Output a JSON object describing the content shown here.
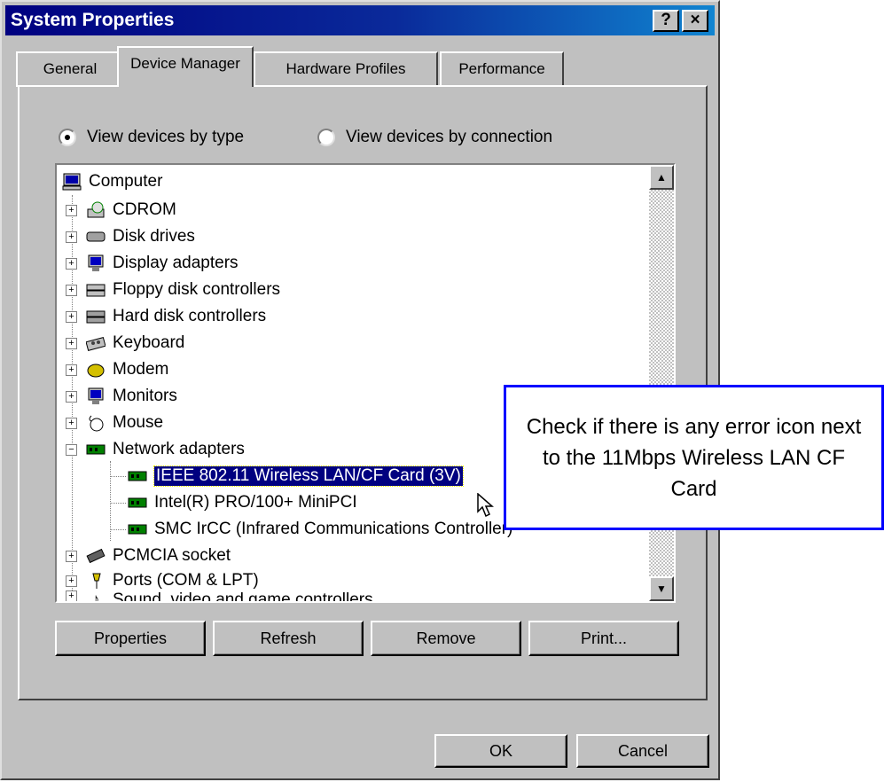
{
  "window": {
    "title": "System Properties",
    "help_glyph": "?",
    "close_glyph": "×"
  },
  "tabs": [
    {
      "label": "General"
    },
    {
      "label": "Device Manager",
      "active": true
    },
    {
      "label": "Hardware Profiles"
    },
    {
      "label": "Performance"
    }
  ],
  "view_options": {
    "by_type": "View devices by type",
    "by_connection": "View devices by connection"
  },
  "tree": {
    "root": "Computer",
    "items": [
      {
        "label": "CDROM",
        "icon": "cdrom-icon"
      },
      {
        "label": "Disk drives",
        "icon": "disk-drive-icon"
      },
      {
        "label": "Display adapters",
        "icon": "display-adapter-icon"
      },
      {
        "label": "Floppy disk controllers",
        "icon": "floppy-controller-icon"
      },
      {
        "label": "Hard disk controllers",
        "icon": "hard-disk-controller-icon"
      },
      {
        "label": "Keyboard",
        "icon": "keyboard-icon"
      },
      {
        "label": "Modem",
        "icon": "modem-icon"
      },
      {
        "label": "Monitors",
        "icon": "monitor-icon"
      },
      {
        "label": "Mouse",
        "icon": "mouse-icon"
      },
      {
        "label": "Network adapters",
        "icon": "network-adapter-icon"
      }
    ],
    "network_children": [
      {
        "label": "IEEE 802.11 Wireless LAN/CF Card (3V)"
      },
      {
        "label": "Intel(R) PRO/100+ MiniPCI"
      },
      {
        "label": "SMC IrCC (Infrared Communications Controller)"
      }
    ],
    "after_items": [
      {
        "label": "PCMCIA socket",
        "icon": "pcmcia-icon"
      },
      {
        "label": "Ports (COM & LPT)",
        "icon": "ports-icon"
      },
      {
        "label": "Sound, video and game controllers",
        "icon": "sound-icon"
      }
    ]
  },
  "buttons": {
    "properties": "Properties",
    "refresh": "Refresh",
    "remove": "Remove",
    "print": "Print...",
    "ok": "OK",
    "cancel": "Cancel"
  },
  "callout": {
    "text": "Check if there is any error icon next to the 11Mbps Wireless LAN CF Card"
  },
  "colors": {
    "title_bar": "#000080",
    "dialog": "#c0c0c0",
    "selection": "#000080",
    "callout_border": "#0000ff"
  }
}
